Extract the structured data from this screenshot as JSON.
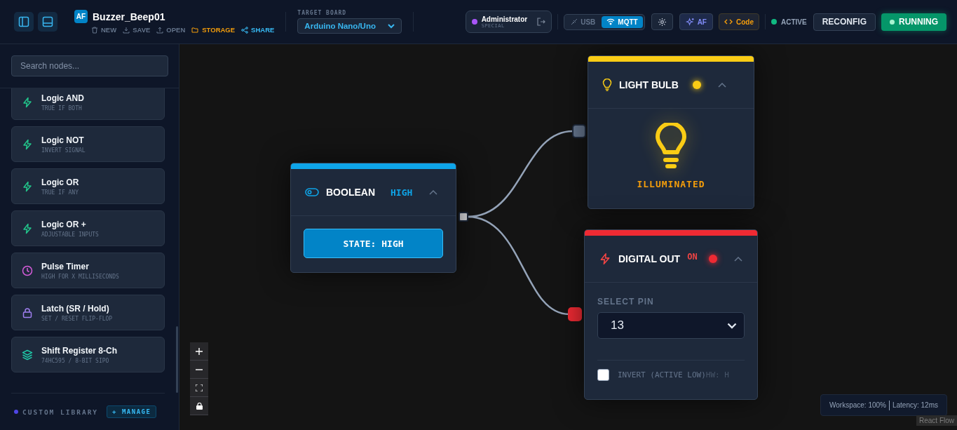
{
  "header": {
    "project": {
      "badge": "AF",
      "name": "Buzzer_Beep01"
    },
    "actions": [
      {
        "label": "NEW",
        "kind": "new"
      },
      {
        "label": "SAVE",
        "kind": "save"
      },
      {
        "label": "OPEN",
        "kind": "open"
      },
      {
        "label": "STORAGE",
        "kind": "storage"
      },
      {
        "label": "SHARE",
        "kind": "share"
      }
    ],
    "target_board": {
      "label": "TARGET BOARD",
      "value": "Arduino Nano/Uno"
    },
    "user": {
      "name": "Administrator",
      "role": "SPECIAL"
    },
    "connection": [
      {
        "label": "USB",
        "selected": false
      },
      {
        "label": "MQTT",
        "selected": true
      }
    ],
    "ai_button": "AF",
    "code_button": "Code",
    "status": {
      "label": "ACTIVE",
      "on": true
    },
    "reconfig": "RECONFIG",
    "run": {
      "label": "RUNNING",
      "on": true
    }
  },
  "sidebar": {
    "search": {
      "placeholder": "Search nodes..."
    },
    "items": [
      {
        "title": "Logic AND",
        "subtitle": "TRUE IF BOTH",
        "kind": "logic"
      },
      {
        "title": "Logic NOT",
        "subtitle": "INVERT SIGNAL",
        "kind": "logic"
      },
      {
        "title": "Logic OR",
        "subtitle": "TRUE IF ANY",
        "kind": "logic"
      },
      {
        "title": "Logic OR +",
        "subtitle": "ADJUSTABLE INPUTS",
        "kind": "logic"
      },
      {
        "title": "Pulse Timer",
        "subtitle": "HIGH FOR X MILLISECONDS",
        "kind": "timer"
      },
      {
        "title": "Latch (SR / Hold)",
        "subtitle": "SET / RESET FLIP-FLOP",
        "kind": "latch"
      },
      {
        "title": "Shift Register 8-Ch",
        "subtitle": "74HC595 / 8-BIT SIPO",
        "kind": "register"
      }
    ],
    "custom_library": {
      "label": "CUSTOM LIBRARY",
      "manage": "+ MANAGE"
    }
  },
  "canvas": {
    "boolean_node": {
      "title": "BOOLEAN",
      "value": "HIGH",
      "button": "STATE: HIGH"
    },
    "light_bulb_node": {
      "title": "LIGHT BULB",
      "lit": true,
      "status": "ILLUMINATED"
    },
    "digital_out_node": {
      "title": "DIGITAL OUT",
      "state": "ON",
      "on": true,
      "pin_label": "SELECT PIN",
      "pin": "13",
      "invert": {
        "label": "INVERT (ACTIVE LOW)",
        "checked": false
      },
      "hw": "HW: H"
    },
    "status_bar": {
      "workspace": "Workspace: 100%",
      "latency": "Latency: 12ms"
    },
    "attribution": "React Flow"
  }
}
